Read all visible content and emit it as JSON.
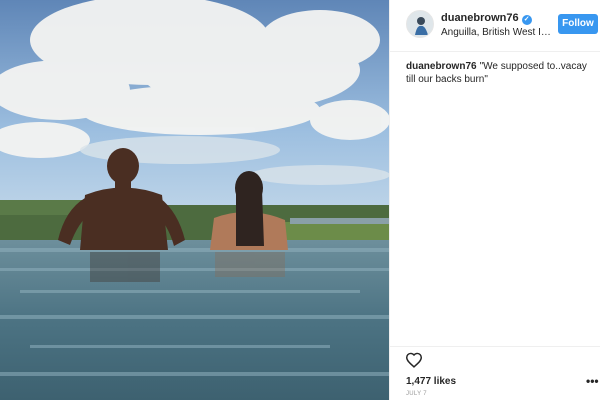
{
  "post": {
    "username": "duanebrown76",
    "verified_badge": "✓",
    "location": "Anguilla, British West In...",
    "follow_label": "Follow",
    "caption_user": "duanebrown76",
    "caption_text": "\"We supposed to..vacay till our backs burn\"",
    "likes": "1,477 likes",
    "date": "JULY 7",
    "more_glyph": "•••"
  },
  "icons": {
    "like": "heart-icon",
    "verified": "verified-badge-icon",
    "more": "more-options-icon"
  },
  "colors": {
    "accent": "#3897f0",
    "border": "#efefef",
    "text": "#262626",
    "muted": "#999999"
  }
}
